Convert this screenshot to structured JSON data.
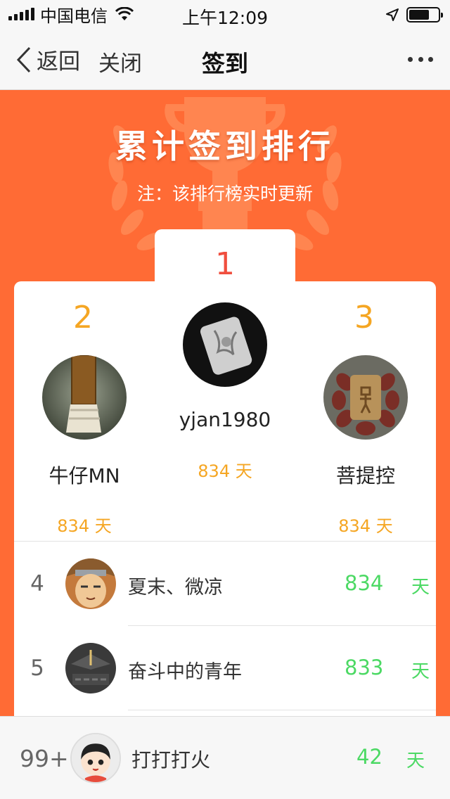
{
  "status_bar": {
    "carrier": "中国电信",
    "time": "上午12:09",
    "icons": [
      "signal-icon",
      "wifi-icon",
      "location-arrow-icon",
      "battery-icon"
    ]
  },
  "nav": {
    "back_label": "返回",
    "close_label": "关闭",
    "title": "签到",
    "more_icon": "more-dots-icon"
  },
  "header": {
    "title": "累计签到排行",
    "note": "注：该排行榜实时更新"
  },
  "colors": {
    "header_bg": "#ff6b35",
    "rank_orange": "#f5a623",
    "rank_red": "#f04e3e",
    "days_green": "#4cd964"
  },
  "podium": {
    "first": {
      "rank": "1",
      "name": "yjan1980",
      "days": "834 天"
    },
    "second": {
      "rank": "2",
      "name": "牛仔MN",
      "days": "834 天"
    },
    "third": {
      "rank": "3",
      "name": "菩提控",
      "days": "834 天"
    }
  },
  "list": [
    {
      "rank": "4",
      "name": "夏末、微凉",
      "days": "834",
      "unit": "天"
    },
    {
      "rank": "5",
      "name": "奋斗中的青年",
      "days": "833",
      "unit": "天"
    }
  ],
  "self": {
    "rank": "99+",
    "name": "打打打火",
    "days": "42",
    "unit": "天"
  }
}
